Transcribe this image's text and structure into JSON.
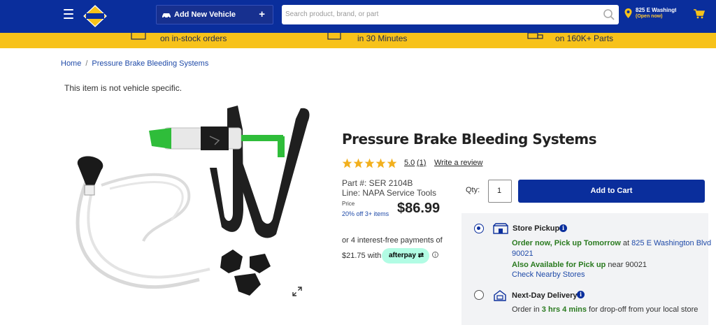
{
  "header": {
    "add_vehicle_label": "Add New Vehicle",
    "search_placeholder": "Search product, brand, or part",
    "store_address": "825 E Washingto",
    "store_status": "(Open now)"
  },
  "promo": {
    "items": [
      "on in-stock orders",
      "in 30 Minutes",
      "on 160K+ Parts"
    ]
  },
  "breadcrumb": {
    "home": "Home",
    "separator": "/",
    "current": "Pressure Brake Bleeding Systems"
  },
  "vehicle_note": "This item is not vehicle specific.",
  "product": {
    "title": "Pressure Brake Bleeding Systems",
    "rating": "5.0",
    "rating_value": 5,
    "review_count": "(1)",
    "write_review": "Write a review",
    "part_number": "Part #: SER 2104B",
    "line": "Line: NAPA Service Tools",
    "price_label": "Price",
    "discount": "20% off 3+ items",
    "price": "$86.99",
    "installments_text": "or 4 interest-free payments of",
    "installment_amount": "$21.75 with",
    "afterpay_label": "afterpay"
  },
  "purchase": {
    "qty_label": "Qty:",
    "qty_value": "1",
    "add_to_cart": "Add to Cart"
  },
  "fulfillment": {
    "pickup": {
      "title": "Store Pickup",
      "order_now": "Order now, Pick up Tomorrow",
      "at": " at ",
      "store_line1": "825 E Washington Blvd",
      "store_line2": "90021",
      "also_available": "Also Available for Pick up",
      "near": " near 90021",
      "check_nearby": "Check Nearby Stores"
    },
    "next_day": {
      "title": "Next-Day Delivery",
      "order_in": "Order in ",
      "time": "3 hrs 4 mins",
      "rest": " for drop-off from your local store"
    }
  },
  "colors": {
    "brand_blue": "#0a2e9c",
    "promo_yellow": "#f7c21a",
    "star_gold": "#f2b01e",
    "afterpay_mint": "#b2fce4",
    "link_blue": "#1f4aa8",
    "success_green": "#2a7a1f"
  }
}
